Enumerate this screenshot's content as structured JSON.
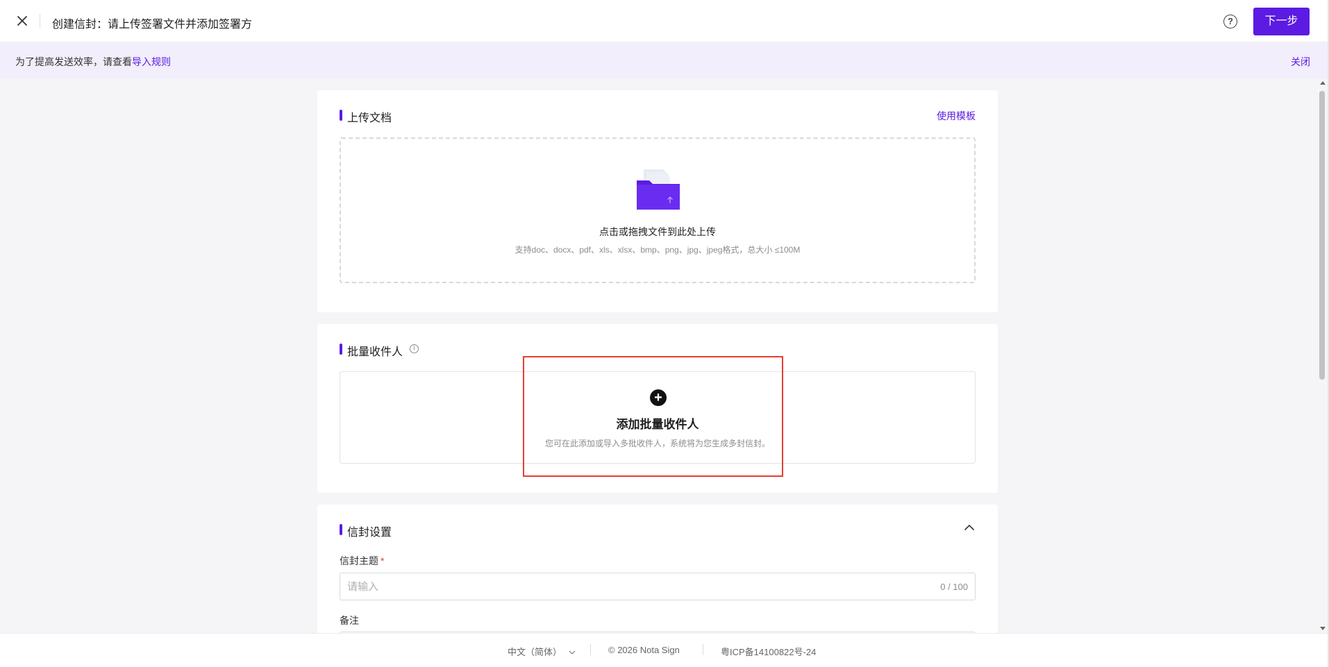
{
  "header": {
    "title": "创建信封：请上传签署文件并添加签署方",
    "help_symbol": "?",
    "next_label": "下一步",
    "close_icon": "close-icon"
  },
  "notice": {
    "text": "为了提高发送效率，请查看",
    "link": "导入规则",
    "close": "关闭"
  },
  "upload": {
    "title": "上传文档",
    "template_link": "使用模板",
    "main_text": "点击或拖拽文件到此处上传",
    "sub_text": "支持doc、docx、pdf、xls、xlsx、bmp、png、jpg、jpeg格式，总大小 ≤100M",
    "icon": "folder-upload-icon",
    "accent": "#5b1be3"
  },
  "batch": {
    "title": "批量收件人",
    "info_symbol": "i",
    "plus_symbol": "+",
    "add_title": "添加批量收件人",
    "add_sub": "您可在此添加或导入多批收件人，系统将为您生成多封信封。",
    "highlight_color": "#e43d30"
  },
  "settings": {
    "title": "信封设置",
    "subject_label": "信封主题",
    "required_mark": "*",
    "subject_placeholder": "请输入",
    "subject_counter": "0 / 100",
    "remark_label": "备注"
  },
  "footer": {
    "language": "中文（简体）",
    "copyright": "© 2026 Nota Sign",
    "icp": "粤ICP备14100822号-24"
  }
}
